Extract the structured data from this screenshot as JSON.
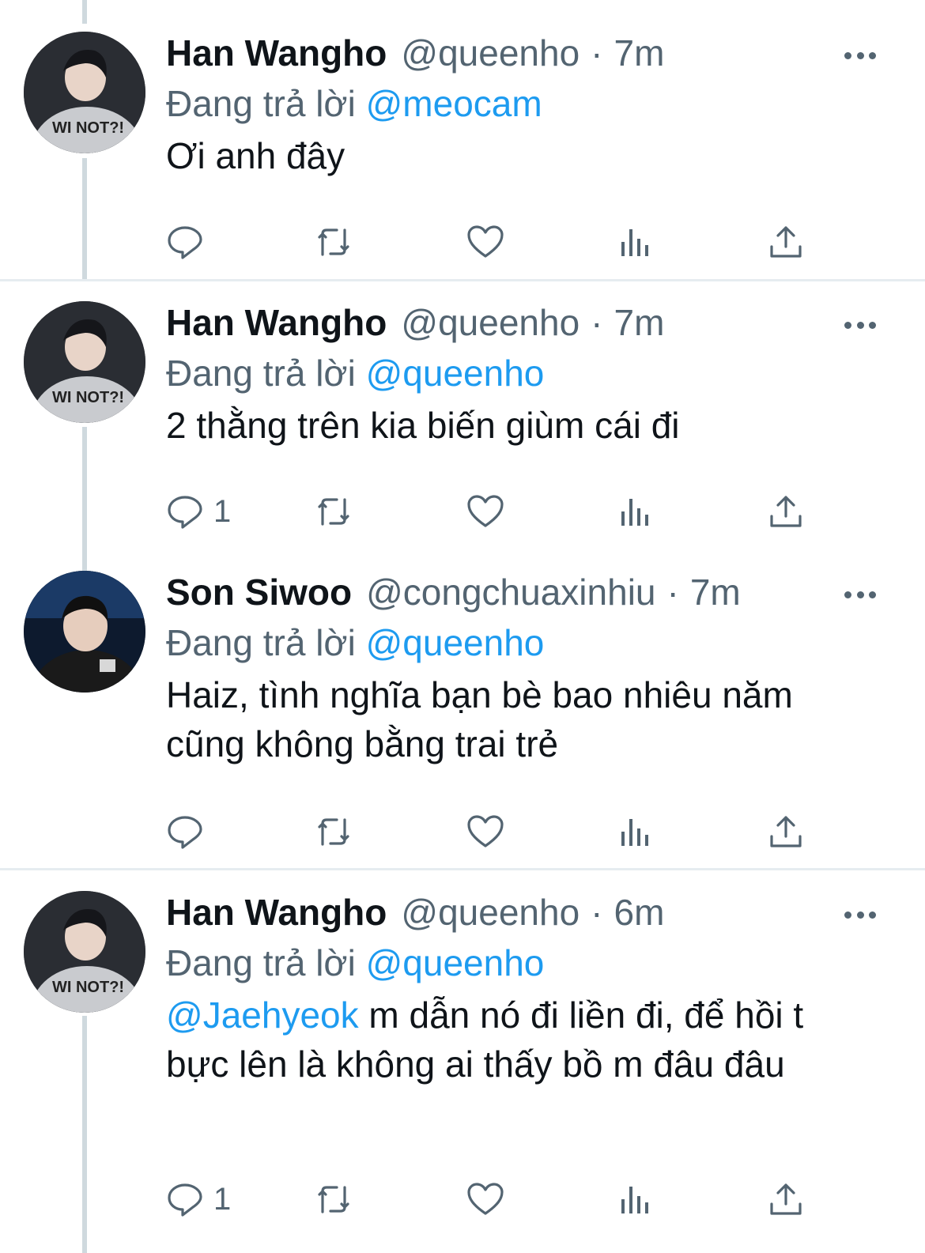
{
  "tweets": [
    {
      "name": "Han Wangho",
      "handle": "@queenho",
      "time": "7m",
      "reply_prefix": "Đang trả lời",
      "reply_to": "@meocam",
      "mention": "",
      "text": "Ơi anh đây",
      "reply_count": "",
      "avatar_icon": "avatar-photo"
    },
    {
      "name": "Han Wangho",
      "handle": "@queenho",
      "time": "7m",
      "reply_prefix": "Đang trả lời",
      "reply_to": "@queenho",
      "mention": "",
      "text": "2 thằng trên kia biến giùm cái đi",
      "reply_count": "1",
      "avatar_icon": "avatar-photo"
    },
    {
      "name": "Son Siwoo",
      "handle": "@congchuaxinhiu",
      "time": "7m",
      "reply_prefix": "Đang trả lời",
      "reply_to": "@queenho",
      "mention": "",
      "text": "Haiz, tình nghĩa bạn bè bao nhiêu năm cũng không bằng trai trẻ",
      "reply_count": "",
      "avatar_icon": "avatar-photo"
    },
    {
      "name": "Han Wangho",
      "handle": "@queenho",
      "time": "6m",
      "reply_prefix": "Đang trả lời",
      "reply_to": "@queenho",
      "mention": "@Jaehyeok",
      "text": " m dẫn nó đi liền đi, để hồi t bực lên là không ai thấy bồ m đâu đâu",
      "reply_count": "1",
      "avatar_icon": "avatar-photo"
    }
  ],
  "colors": {
    "link": "#1d9bf0",
    "secondary": "#536471",
    "divider": "#e6ecf0"
  },
  "icons": [
    "reply-icon",
    "retweet-icon",
    "like-icon",
    "analytics-icon",
    "share-icon",
    "more-icon"
  ]
}
